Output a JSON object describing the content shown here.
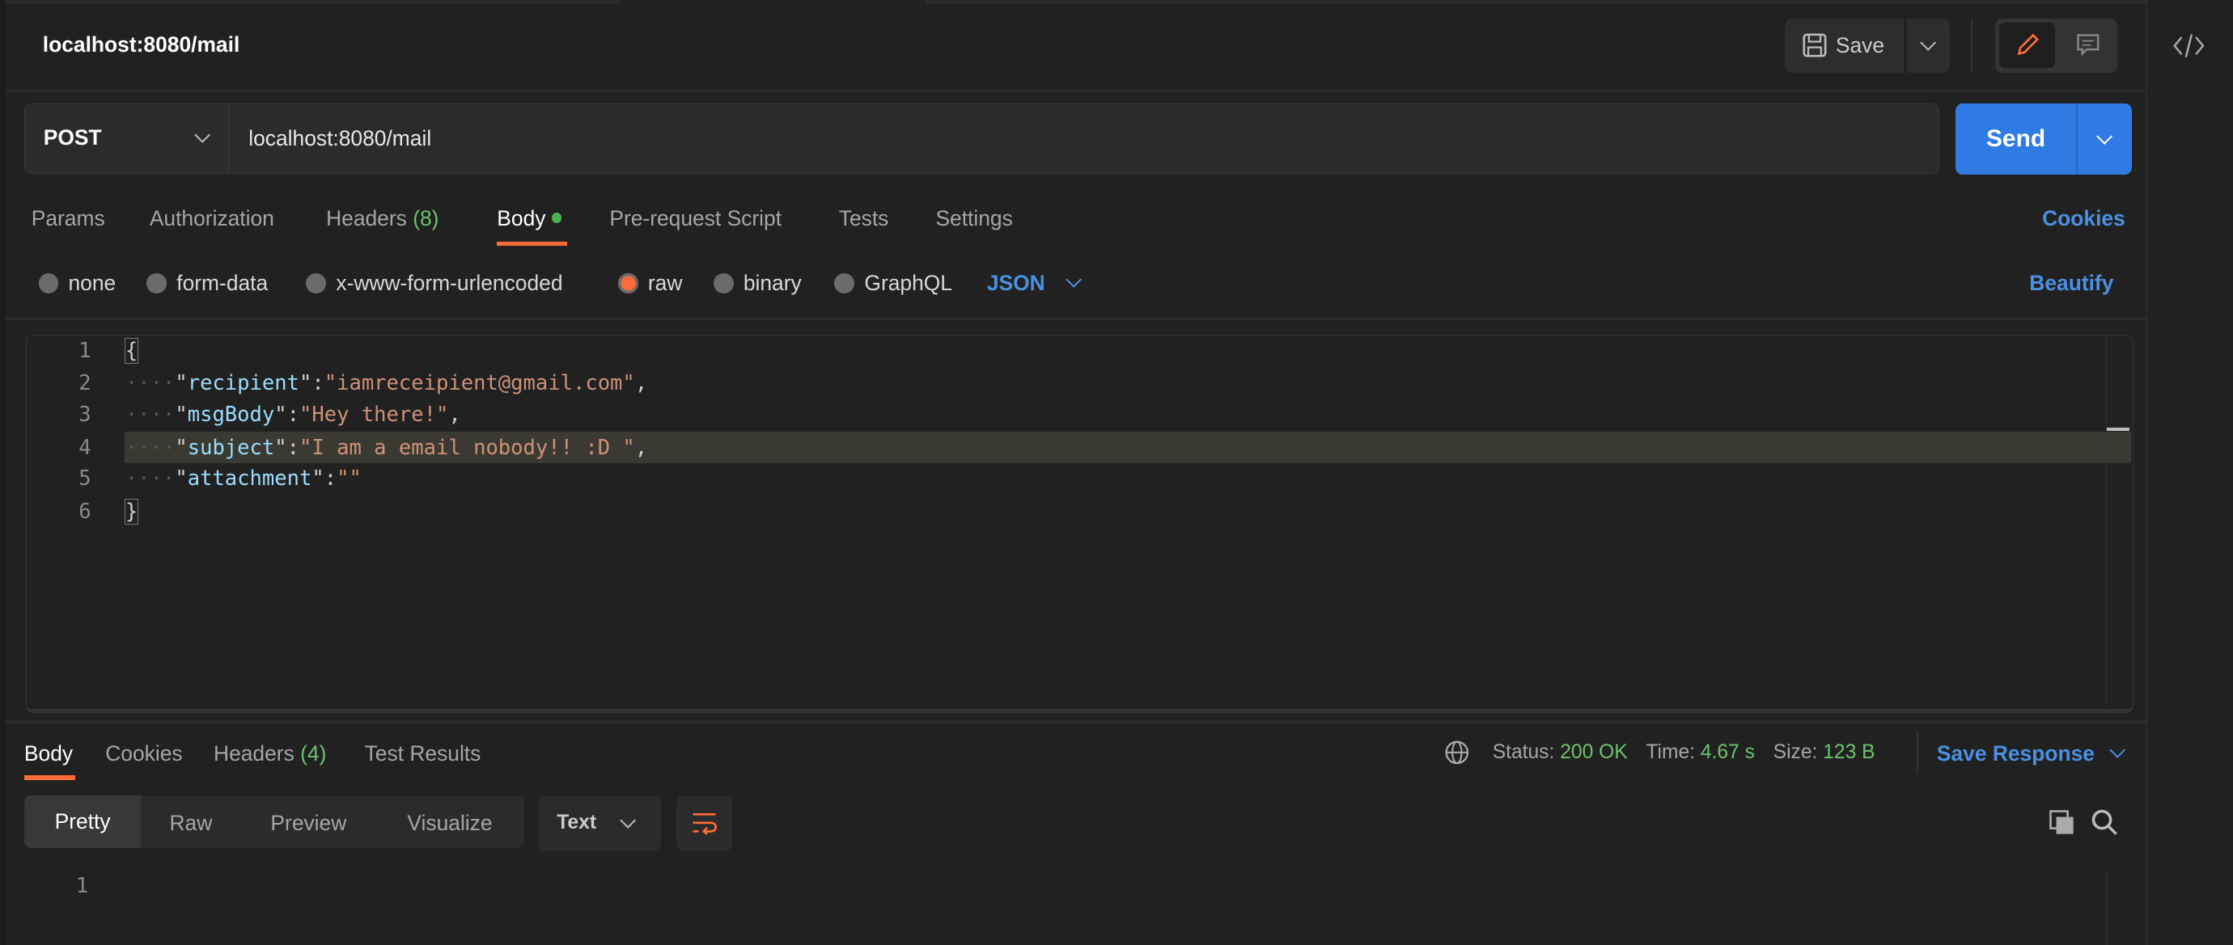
{
  "request": {
    "title": "localhost:8080/mail",
    "save_label": "Save",
    "method": "POST",
    "url": "localhost:8080/mail",
    "send_label": "Send"
  },
  "request_tabs": [
    {
      "label": "Params"
    },
    {
      "label": "Authorization"
    },
    {
      "label": "Headers",
      "count": "(8)"
    },
    {
      "label": "Body",
      "active": true
    },
    {
      "label": "Pre-request Script"
    },
    {
      "label": "Tests"
    },
    {
      "label": "Settings"
    }
  ],
  "cookies_label": "Cookies",
  "body_types": [
    {
      "label": "none"
    },
    {
      "label": "form-data"
    },
    {
      "label": "x-www-form-urlencoded"
    },
    {
      "label": "raw",
      "selected": true
    },
    {
      "label": "binary"
    },
    {
      "label": "GraphQL"
    }
  ],
  "format": "JSON",
  "beautify_label": "Beautify",
  "editor": {
    "line_numbers": [
      "1",
      "2",
      "3",
      "4",
      "5",
      "6"
    ],
    "lines": [
      {
        "key": "recipient",
        "value": "iamreceipient@gmail.com",
        "comma": ","
      },
      {
        "key": "msgBody",
        "value": "Hey there!",
        "comma": ","
      },
      {
        "key": "subject",
        "value": "I am a email nobody!! :D ",
        "comma": ","
      },
      {
        "key": "attachment",
        "value": "",
        "comma": ""
      }
    ],
    "open_brace": "{",
    "close_brace": "}",
    "highlighted_line": 4
  },
  "response": {
    "tabs": [
      {
        "label": "Body",
        "active": true
      },
      {
        "label": "Cookies"
      },
      {
        "label": "Headers",
        "count": "(4)"
      },
      {
        "label": "Test Results"
      }
    ],
    "status_label": "Status:",
    "status": "200 OK",
    "time_label": "Time:",
    "time": "4.67 s",
    "size_label": "Size:",
    "size": "123 B",
    "save_response_label": "Save Response",
    "view_modes": [
      "Pretty",
      "Raw",
      "Preview",
      "Visualize"
    ],
    "format": "Text",
    "line_numbers": [
      "1"
    ]
  },
  "colors": {
    "accent": "#ff6c37",
    "send": "#2f7be3",
    "link": "#4a90e2",
    "status": "#6cc26c"
  }
}
